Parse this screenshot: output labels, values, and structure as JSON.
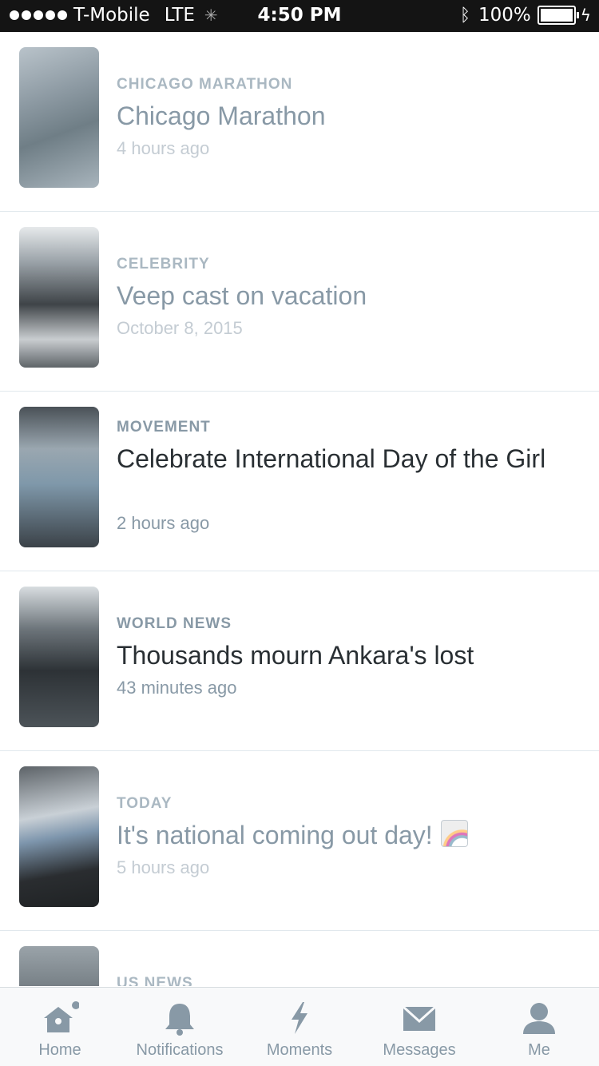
{
  "status_bar": {
    "carrier": "T-Mobile",
    "network": "LTE",
    "time": "4:50 PM",
    "battery_percent": "100%",
    "battery_level": 1.0
  },
  "feed": {
    "items": [
      {
        "category": "CHICAGO MARATHON",
        "title": "Chicago Marathon",
        "time": "4 hours ago",
        "thumbnail": "marathon-photo"
      },
      {
        "category": "CELEBRITY",
        "title": "Veep cast on vacation",
        "time": "October 8, 2015",
        "thumbnail": "veep-cast-photo"
      },
      {
        "category": "MOVEMENT",
        "title": "Celebrate International Day of the Girl",
        "time": "2 hours ago",
        "thumbnail": "girls-photo"
      },
      {
        "category": "WORLD NEWS",
        "title": "Thousands mourn Ankara's lost",
        "time": "43 minutes ago",
        "thumbnail": "ankara-crowd-photo"
      },
      {
        "category": "TODAY",
        "title": "It's national coming out day!",
        "time": "5 hours ago",
        "thumbnail": "coming-out-photo",
        "emoji": "rainbow-icon"
      },
      {
        "category": "US NEWS",
        "title": "",
        "time": "",
        "thumbnail": "us-news-photo"
      }
    ]
  },
  "tab_bar": {
    "tabs": [
      {
        "label": "Home",
        "icon": "home-icon",
        "has_badge": true
      },
      {
        "label": "Notifications",
        "icon": "bell-icon"
      },
      {
        "label": "Moments",
        "icon": "lightning-icon"
      },
      {
        "label": "Messages",
        "icon": "envelope-icon"
      },
      {
        "label": "Me",
        "icon": "person-icon"
      }
    ]
  },
  "colors": {
    "muted_text": "#8899a6",
    "light_text": "#aab8c2",
    "dark_text": "#292f33",
    "divider": "#e1e8ed"
  }
}
